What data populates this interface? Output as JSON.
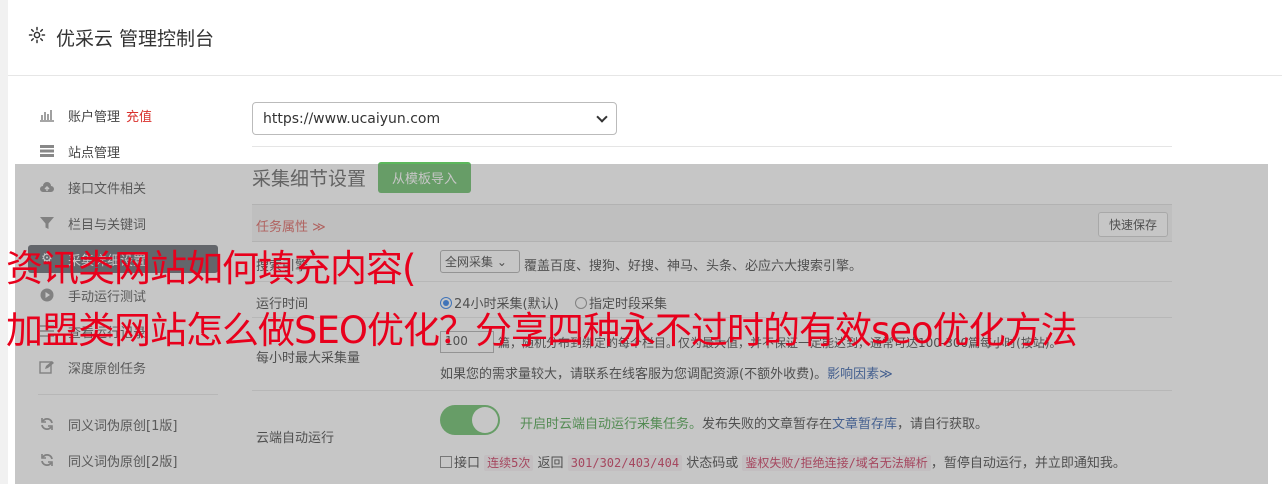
{
  "header": {
    "title": "优采云 管理控制台"
  },
  "sidebar": {
    "items": [
      {
        "label": "账户管理",
        "badge": "充值"
      },
      {
        "label": "站点管理"
      },
      {
        "label": "接口文件相关"
      },
      {
        "label": "栏目与关键词"
      },
      {
        "label": "采集详细设置"
      },
      {
        "label": "手动运行测试"
      },
      {
        "label": "查看运行记录"
      },
      {
        "label": "深度原创任务"
      },
      {
        "label": "同义词伪原创[1版]"
      },
      {
        "label": "同义词伪原创[2版]"
      }
    ]
  },
  "main": {
    "site_select": "https://www.ucaiyun.com",
    "section_title": "采集细节设置",
    "import_button": "从模板导入",
    "task_attr": "任务属性 ≫",
    "quick_save": "快速保存",
    "engine": {
      "label": "搜索引擎",
      "select": "全网采集",
      "desc": "覆盖百度、搜狗、好搜、神马、头条、必应六大搜索引擎。"
    },
    "run_time": {
      "label": "运行时间",
      "opt1": "24小时采集(默认)",
      "opt2": "指定时段采集"
    },
    "hourly": {
      "label": "每小时最大采集量",
      "value": "100",
      "line1": "篇，随机分布到绑定的每个栏目。仅为最大值，并不保证一定能达到，通常可达100-300篇每小时(按站)。",
      "line2": "如果您的需求量较大，请联系在线客服为您调配资源(不额外收费)。",
      "line2_link": "影响因素≫"
    },
    "cloud": {
      "label": "云端自动运行",
      "enabled_text": "开启时云端自动运行采集任务。",
      "desc_pre": "发布失败的文章暂存在",
      "desc_link": "文章暂存库",
      "desc_post": "，请自行获取。",
      "cb_text1": "接口",
      "cb_code1": "连续5次",
      "cb_text2": "返回",
      "cb_code2": "301/302/403/404",
      "cb_text3": "状态码或",
      "cb_code3": "鉴权失败/拒绝连接/域名无法解析",
      "cb_text4": "，暂停自动运行，并立即通知我。"
    }
  },
  "overlay": {
    "line1": "资讯类网站如何填充内容(",
    "line2": "加盟类网站怎么做SEO优化？分享四种永不过时的有效seo优化方法"
  },
  "colors": {
    "accent_green": "#5cb85c",
    "active_nav": "#555a62",
    "headline_red": "#e8001c"
  }
}
